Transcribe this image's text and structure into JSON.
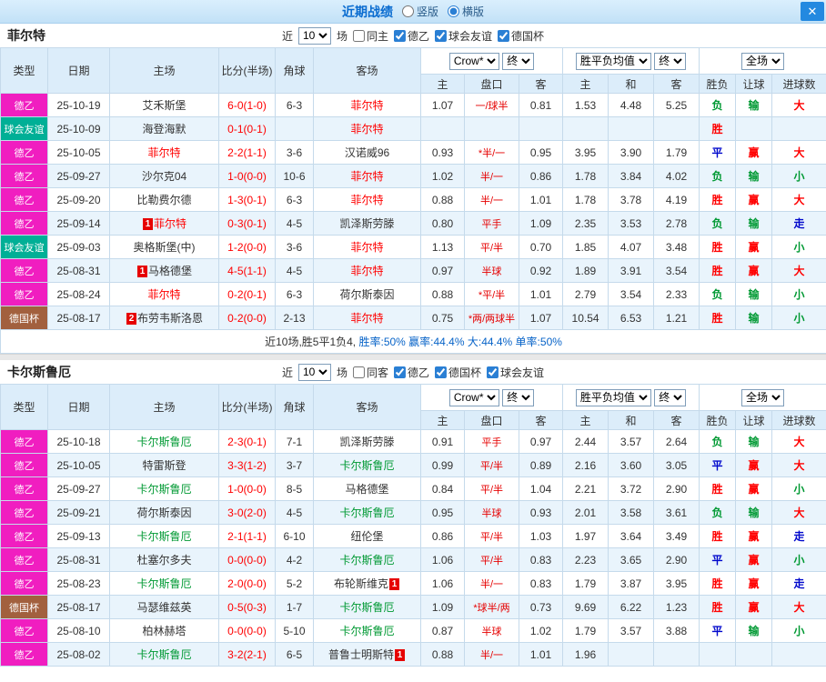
{
  "titlebar": {
    "title": "近期战绩",
    "radio_vertical": "竖版",
    "radio_horizontal": "横版",
    "vertical_checked": false,
    "horizontal_checked": true,
    "close_label": "✕"
  },
  "controls": {
    "near": "近",
    "count": "10",
    "matches": "场",
    "bookmaker": "Crow*",
    "final": "终",
    "avg_label": "胜平负均值",
    "fullmatch": "全场"
  },
  "columns": {
    "type": "类型",
    "date": "日期",
    "home": "主场",
    "score": "比分(半场)",
    "corner": "角球",
    "away": "客场",
    "odds_home": "主",
    "handicap": "盘口",
    "odds_away": "客",
    "avg_home": "主",
    "avg_draw": "和",
    "avg_away": "客",
    "result": "胜负",
    "handicap_result": "让球",
    "goals": "进球数"
  },
  "colors": {
    "league_de2": "#f01ec0",
    "league_friendly": "#00af96",
    "league_cup": "#a2603e",
    "win_red": "#ff0000",
    "lose_green": "#009933",
    "draw_blue": "#0008cc",
    "home_team_red": "#ff0000",
    "away_team_green": "#009933",
    "titlebar_blue": "#c2e1f7",
    "header_cell_blue": "#dcedfa",
    "alt_row_blue": "#e9f4fc"
  },
  "team1": {
    "name": "菲尔特",
    "filters": {
      "same": "同主",
      "same_checked": false,
      "l1": "德乙",
      "l1_checked": true,
      "l2": "球会友谊",
      "l2_checked": true,
      "l3": "德国杯",
      "l3_checked": true
    },
    "rows": [
      {
        "t": "德乙",
        "tc": "lg-p",
        "d": "25-10-19",
        "h": "艾禾斯堡",
        "s": "6-0(1-0)",
        "cn": "6-3",
        "a": "菲尔特",
        "ac": "red",
        "o1": "1.07",
        "o2": "一/球半",
        "o3": "0.81",
        "m1": "1.53",
        "m2": "4.48",
        "m3": "5.25",
        "r1": "负",
        "c1": "cg",
        "r2": "输",
        "c2": "cg",
        "r3": "大",
        "c3": "cr"
      },
      {
        "t": "球会友谊",
        "tc": "lg-t",
        "d": "25-10-09",
        "h": "海登海默",
        "s": "0-1(0-1)",
        "a": "菲尔特",
        "ac": "red",
        "r1": "胜",
        "c1": "cr"
      },
      {
        "t": "德乙",
        "tc": "lg-p",
        "d": "25-10-05",
        "h": "菲尔特",
        "hc": "red",
        "s": "2-2(1-1)",
        "cn": "3-6",
        "a": "汉诺威96",
        "o1": "0.93",
        "o2": "*半/一",
        "o3": "0.95",
        "m1": "3.95",
        "m2": "3.90",
        "m3": "1.79",
        "r1": "平",
        "c1": "cb",
        "r2": "赢",
        "c2": "cr",
        "r3": "大",
        "c3": "cr"
      },
      {
        "t": "德乙",
        "tc": "lg-p",
        "d": "25-09-27",
        "h": "沙尔克04",
        "s": "1-0(0-0)",
        "cn": "10-6",
        "a": "菲尔特",
        "ac": "red",
        "o1": "1.02",
        "o2": "半/一",
        "o3": "0.86",
        "m1": "1.78",
        "m2": "3.84",
        "m3": "4.02",
        "r1": "负",
        "c1": "cg",
        "r2": "输",
        "c2": "cg",
        "r3": "小",
        "c3": "cg"
      },
      {
        "t": "德乙",
        "tc": "lg-p",
        "d": "25-09-20",
        "h": "比勒费尔德",
        "s": "1-3(0-1)",
        "cn": "6-3",
        "a": "菲尔特",
        "ac": "red",
        "o1": "0.88",
        "o2": "半/一",
        "o3": "1.01",
        "m1": "1.78",
        "m2": "3.78",
        "m3": "4.19",
        "r1": "胜",
        "c1": "cr",
        "r2": "赢",
        "c2": "cr",
        "r3": "大",
        "c3": "cr"
      },
      {
        "t": "德乙",
        "tc": "lg-p",
        "d": "25-09-14",
        "hb": "1",
        "h": "菲尔特",
        "hc": "red",
        "s": "0-3(0-1)",
        "cn": "4-5",
        "a": "凯泽斯劳滕",
        "o1": "0.80",
        "o2": "平手",
        "o3": "1.09",
        "m1": "2.35",
        "m2": "3.53",
        "m3": "2.78",
        "r1": "负",
        "c1": "cg",
        "r2": "输",
        "c2": "cg",
        "r3": "走",
        "c3": "cb"
      },
      {
        "t": "球会友谊",
        "tc": "lg-t",
        "d": "25-09-03",
        "h": "奥格斯堡(中)",
        "s": "1-2(0-0)",
        "cn": "3-6",
        "a": "菲尔特",
        "ac": "red",
        "o1": "1.13",
        "o2": "平/半",
        "o3": "0.70",
        "m1": "1.85",
        "m2": "4.07",
        "m3": "3.48",
        "r1": "胜",
        "c1": "cr",
        "r2": "赢",
        "c2": "cr",
        "r3": "小",
        "c3": "cg"
      },
      {
        "t": "德乙",
        "tc": "lg-p",
        "d": "25-08-31",
        "hb": "1",
        "h": "马格德堡",
        "s": "4-5(1-1)",
        "cn": "4-5",
        "a": "菲尔特",
        "ac": "red",
        "o1": "0.97",
        "o2": "半球",
        "o3": "0.92",
        "m1": "1.89",
        "m2": "3.91",
        "m3": "3.54",
        "r1": "胜",
        "c1": "cr",
        "r2": "赢",
        "c2": "cr",
        "r3": "大",
        "c3": "cr"
      },
      {
        "t": "德乙",
        "tc": "lg-p",
        "d": "25-08-24",
        "h": "菲尔特",
        "hc": "red",
        "s": "0-2(0-1)",
        "cn": "6-3",
        "a": "荷尔斯泰因",
        "o1": "0.88",
        "o2": "*平/半",
        "o3": "1.01",
        "m1": "2.79",
        "m2": "3.54",
        "m3": "2.33",
        "r1": "负",
        "c1": "cg",
        "r2": "输",
        "c2": "cg",
        "r3": "小",
        "c3": "cg"
      },
      {
        "t": "德国杯",
        "tc": "lg-b",
        "d": "25-08-17",
        "hb": "2",
        "h": "布劳韦斯洛恩",
        "s": "0-2(0-0)",
        "cn": "2-13",
        "a": "菲尔特",
        "ac": "red",
        "o1": "0.75",
        "o2": "*两/两球半",
        "o3": "1.07",
        "m1": "10.54",
        "m2": "6.53",
        "m3": "1.21",
        "r1": "胜",
        "c1": "cr",
        "r2": "输",
        "c2": "cg",
        "r3": "小",
        "c3": "cg"
      }
    ],
    "summary_prefix": "近10场,胜5平1负4,",
    "summary_stats": "胜率:50% 赢率:44.4% 大:44.4% 单率:50%"
  },
  "team2": {
    "name": "卡尔斯鲁厄",
    "filters": {
      "same": "同客",
      "same_checked": false,
      "l1": "德乙",
      "l1_checked": true,
      "l2": "德国杯",
      "l2_checked": true,
      "l3": "球会友谊",
      "l3_checked": true
    },
    "rows": [
      {
        "t": "德乙",
        "tc": "lg-p",
        "d": "25-10-18",
        "h": "卡尔斯鲁厄",
        "hc": "green",
        "s": "2-3(0-1)",
        "cn": "7-1",
        "a": "凯泽斯劳滕",
        "o1": "0.91",
        "o2": "平手",
        "o3": "0.97",
        "m1": "2.44",
        "m2": "3.57",
        "m3": "2.64",
        "r1": "负",
        "c1": "cg",
        "r2": "输",
        "c2": "cg",
        "r3": "大",
        "c3": "cr"
      },
      {
        "t": "德乙",
        "tc": "lg-p",
        "d": "25-10-05",
        "h": "特雷斯登",
        "s": "3-3(1-2)",
        "cn": "3-7",
        "a": "卡尔斯鲁厄",
        "ac": "green",
        "o1": "0.99",
        "o2": "平/半",
        "o3": "0.89",
        "m1": "2.16",
        "m2": "3.60",
        "m3": "3.05",
        "r1": "平",
        "c1": "cb",
        "r2": "赢",
        "c2": "cr",
        "r3": "大",
        "c3": "cr"
      },
      {
        "t": "德乙",
        "tc": "lg-p",
        "d": "25-09-27",
        "h": "卡尔斯鲁厄",
        "hc": "green",
        "s": "1-0(0-0)",
        "cn": "8-5",
        "a": "马格德堡",
        "o1": "0.84",
        "o2": "平/半",
        "o3": "1.04",
        "m1": "2.21",
        "m2": "3.72",
        "m3": "2.90",
        "r1": "胜",
        "c1": "cr",
        "r2": "赢",
        "c2": "cr",
        "r3": "小",
        "c3": "cg"
      },
      {
        "t": "德乙",
        "tc": "lg-p",
        "d": "25-09-21",
        "h": "荷尔斯泰因",
        "s": "3-0(2-0)",
        "cn": "4-5",
        "a": "卡尔斯鲁厄",
        "ac": "green",
        "o1": "0.95",
        "o2": "半球",
        "o3": "0.93",
        "m1": "2.01",
        "m2": "3.58",
        "m3": "3.61",
        "r1": "负",
        "c1": "cg",
        "r2": "输",
        "c2": "cg",
        "r3": "大",
        "c3": "cr"
      },
      {
        "t": "德乙",
        "tc": "lg-p",
        "d": "25-09-13",
        "h": "卡尔斯鲁厄",
        "hc": "green",
        "s": "2-1(1-1)",
        "cn": "6-10",
        "a": "纽伦堡",
        "o1": "0.86",
        "o2": "平/半",
        "o3": "1.03",
        "m1": "1.97",
        "m2": "3.64",
        "m3": "3.49",
        "r1": "胜",
        "c1": "cr",
        "r2": "赢",
        "c2": "cr",
        "r3": "走",
        "c3": "cb"
      },
      {
        "t": "德乙",
        "tc": "lg-p",
        "d": "25-08-31",
        "h": "杜塞尔多夫",
        "s": "0-0(0-0)",
        "cn": "4-2",
        "a": "卡尔斯鲁厄",
        "ac": "green",
        "o1": "1.06",
        "o2": "平/半",
        "o3": "0.83",
        "m1": "2.23",
        "m2": "3.65",
        "m3": "2.90",
        "r1": "平",
        "c1": "cb",
        "r2": "赢",
        "c2": "cr",
        "r3": "小",
        "c3": "cg"
      },
      {
        "t": "德乙",
        "tc": "lg-p",
        "d": "25-08-23",
        "h": "卡尔斯鲁厄",
        "hc": "green",
        "s": "2-0(0-0)",
        "cn": "5-2",
        "a": "布轮斯维克",
        "ab": "1",
        "o1": "1.06",
        "o2": "半/一",
        "o3": "0.83",
        "m1": "1.79",
        "m2": "3.87",
        "m3": "3.95",
        "r1": "胜",
        "c1": "cr",
        "r2": "赢",
        "c2": "cr",
        "r3": "走",
        "c3": "cb"
      },
      {
        "t": "德国杯",
        "tc": "lg-b",
        "d": "25-08-17",
        "h": "马瑟维兹英",
        "s": "0-5(0-3)",
        "cn": "1-7",
        "a": "卡尔斯鲁厄",
        "ac": "green",
        "o1": "1.09",
        "o2": "*球半/两",
        "o3": "0.73",
        "m1": "9.69",
        "m2": "6.22",
        "m3": "1.23",
        "r1": "胜",
        "c1": "cr",
        "r2": "赢",
        "c2": "cr",
        "r3": "大",
        "c3": "cr"
      },
      {
        "t": "德乙",
        "tc": "lg-p",
        "d": "25-08-10",
        "h": "柏林赫塔",
        "s": "0-0(0-0)",
        "cn": "5-10",
        "a": "卡尔斯鲁厄",
        "ac": "green",
        "o1": "0.87",
        "o2": "半球",
        "o3": "1.02",
        "m1": "1.79",
        "m2": "3.57",
        "m3": "3.88",
        "r1": "平",
        "c1": "cb",
        "r2": "输",
        "c2": "cg",
        "r3": "小",
        "c3": "cg"
      },
      {
        "t": "德乙",
        "tc": "lg-p",
        "d": "25-08-02",
        "h": "卡尔斯鲁厄",
        "hc": "green",
        "s": "3-2(2-1)",
        "cn": "6-5",
        "a": "普鲁士明斯特",
        "ab": "1",
        "o1": "0.88",
        "o2": "半/一",
        "o3": "1.01",
        "m1": "1.96"
      }
    ]
  }
}
